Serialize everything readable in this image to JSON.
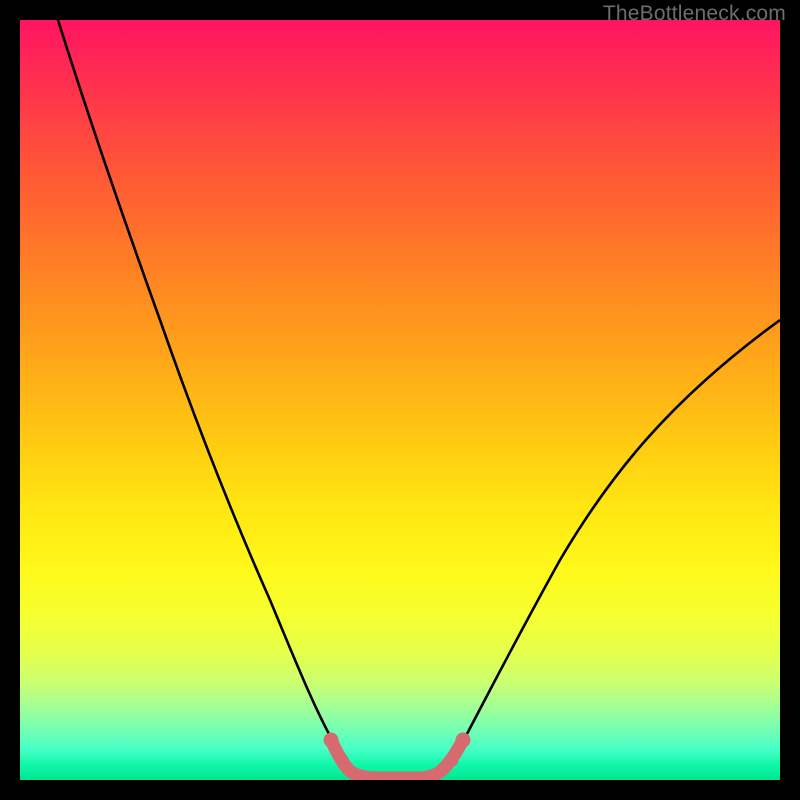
{
  "watermark": {
    "text": "TheBottleneck.com"
  },
  "colors": {
    "background": "#000000",
    "curve_stroke": "#000000",
    "marker_stroke": "#d66a6f",
    "gradient_top": "#ff1462",
    "gradient_bottom": "#00e890"
  },
  "chart_data": {
    "type": "line",
    "title": "",
    "xlabel": "",
    "ylabel": "",
    "xrange": [
      0,
      100
    ],
    "ylim": [
      0,
      100
    ],
    "grid": false,
    "legend": false,
    "series": [
      {
        "name": "curve",
        "x": [
          5,
          8,
          12,
          16,
          20,
          24,
          28,
          32,
          36,
          38,
          40,
          41.5,
          43,
          46,
          49,
          52,
          54,
          56,
          58,
          62,
          66,
          72,
          80,
          90,
          100
        ],
        "y": [
          100,
          88,
          74,
          62,
          51,
          41,
          32,
          23,
          14,
          9,
          5,
          2.5,
          1,
          0.3,
          0.3,
          1,
          2.5,
          5,
          9,
          17,
          25,
          34,
          44,
          53,
          60
        ]
      },
      {
        "name": "highlight",
        "x": [
          41.5,
          43,
          46,
          49,
          52,
          54
        ],
        "y": [
          2.5,
          1,
          0.3,
          0.3,
          1,
          2.5
        ]
      }
    ],
    "annotations": []
  }
}
